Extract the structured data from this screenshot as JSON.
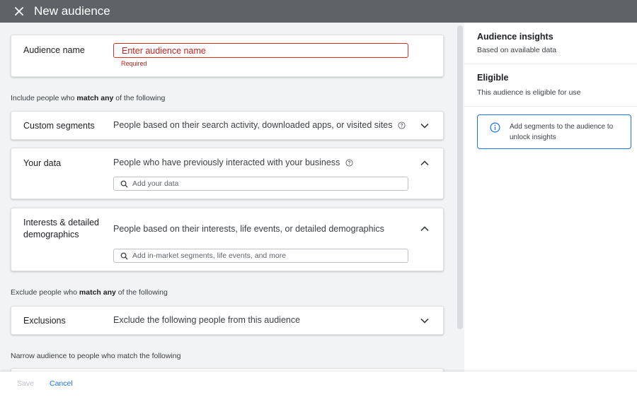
{
  "header": {
    "title": "New audience",
    "close_icon": "close-icon"
  },
  "audience_name": {
    "label": "Audience name",
    "placeholder": "Enter audience name",
    "error": "Required"
  },
  "include_section": {
    "prefix": "Include people who ",
    "bold": "match any",
    "suffix": " of the following"
  },
  "custom_segments": {
    "label": "Custom segments",
    "description": "People based on their search activity, downloaded apps, or visited sites"
  },
  "your_data": {
    "label": "Your data",
    "description": "People who have previously interacted with your business",
    "search_placeholder": "Add your data"
  },
  "interests": {
    "label_line1": "Interests & detailed",
    "label_line2": "demographics",
    "description": "People based on their interests, life events, or detailed demographics",
    "search_placeholder": "Add in-market segments, life events, and more"
  },
  "exclude_section": {
    "prefix": "Exclude people who ",
    "bold": "match any",
    "suffix": " of the following"
  },
  "exclusions": {
    "label": "Exclusions",
    "description": "Exclude the following people from this audience"
  },
  "narrow_section": {
    "text": "Narrow audience to people who match the following"
  },
  "insights_panel": {
    "title": "Audience insights",
    "subtitle": "Based on available data",
    "eligible_title": "Eligible",
    "eligible_subtitle": "This audience is eligible for use",
    "info_text": "Add segments to the audience to unlock insights"
  },
  "footer": {
    "save_label": "Save",
    "cancel_label": "Cancel"
  },
  "colors": {
    "accent": "#1a73e8",
    "error": "#d93025",
    "topbar": "#5f6368"
  }
}
